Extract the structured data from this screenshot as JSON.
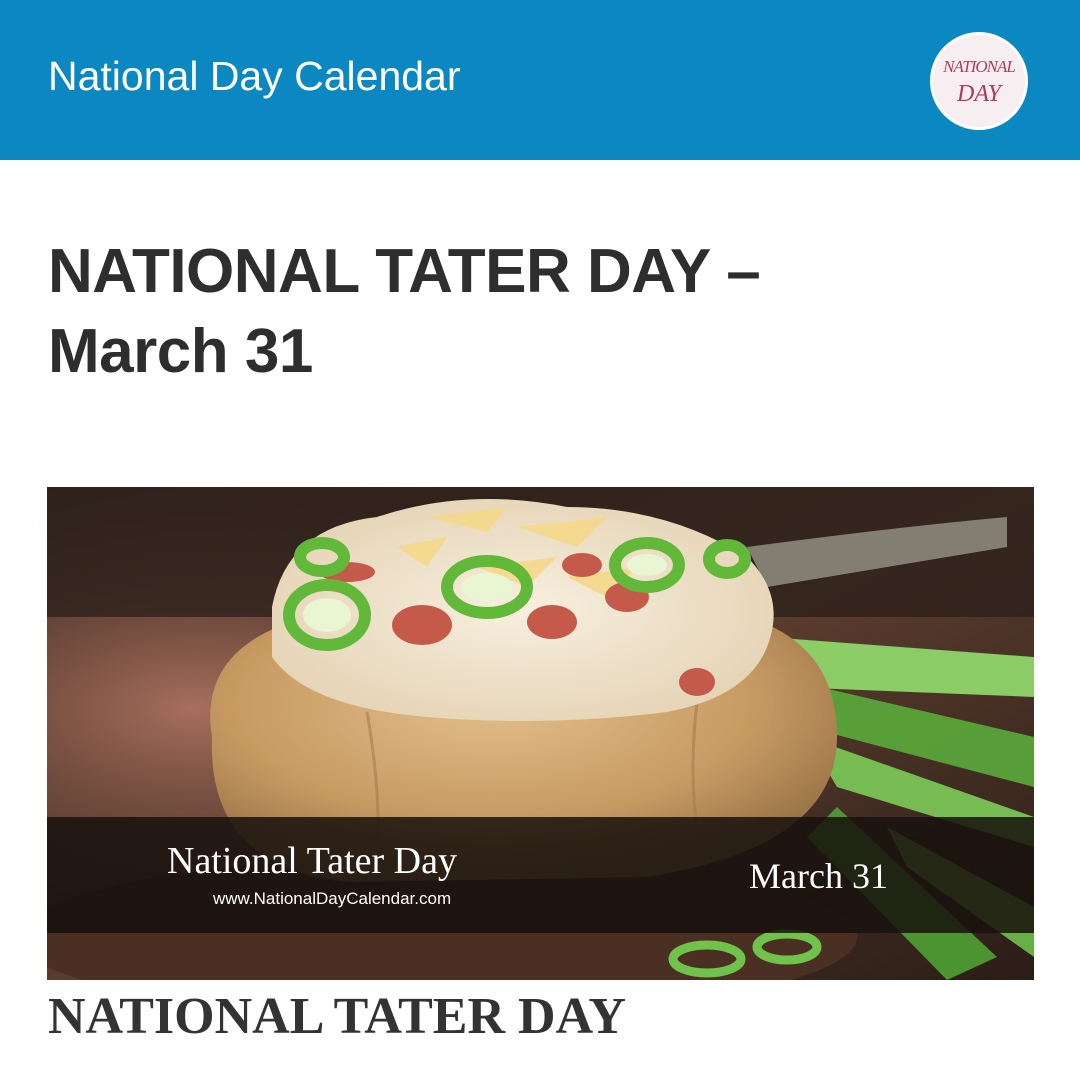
{
  "header": {
    "site_title": "National Day Calendar",
    "logo_line1": "NATIONAL",
    "logo_line2": "DAY",
    "background_color": "#0b88c2"
  },
  "article": {
    "headline": "NATIONAL TATER DAY – March 31",
    "featured_image": {
      "subject": "loaded baked potato with bacon, cheese and green onions",
      "banner_title": "National Tater Day",
      "banner_url": "www.NationalDayCalendar.com",
      "banner_date": "March 31"
    },
    "section_heading": "NATIONAL TATER DAY"
  }
}
